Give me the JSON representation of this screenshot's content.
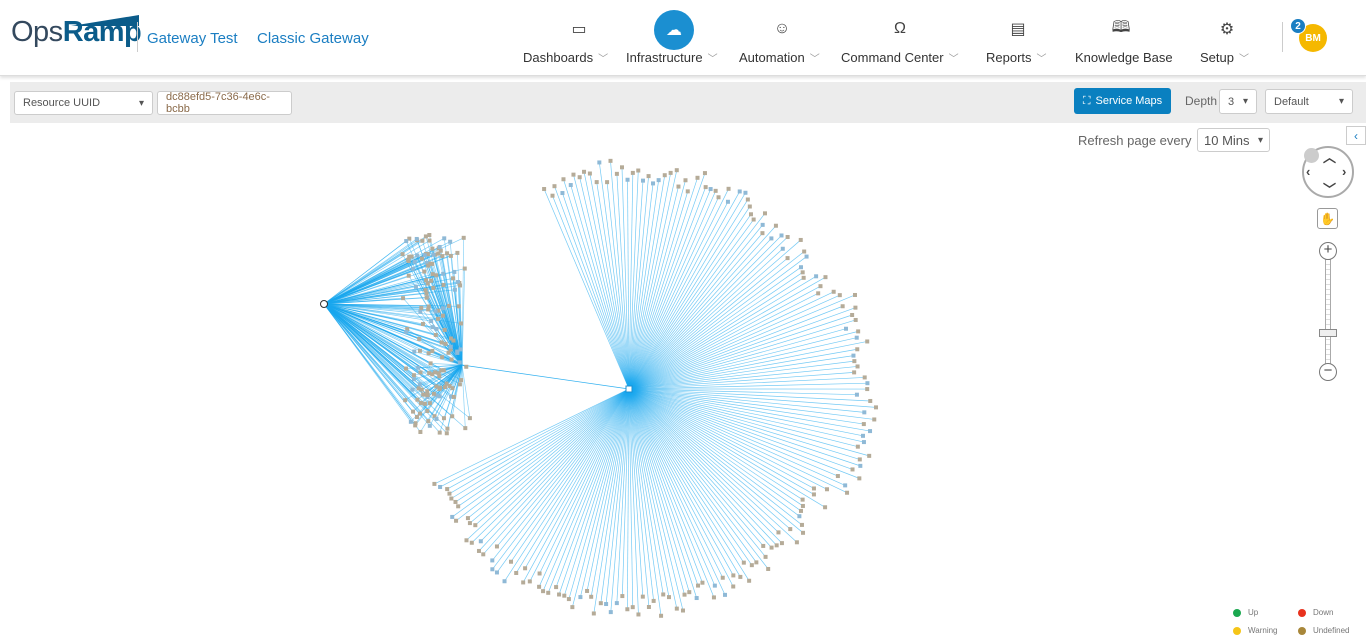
{
  "header": {
    "logo": "OpsRamp",
    "links": [
      "Gateway Test",
      "Classic Gateway"
    ],
    "nav": [
      {
        "label": "Dashboards",
        "icon": "dashboard-icon",
        "dropdown": true
      },
      {
        "label": "Infrastructure",
        "icon": "cloud-network-icon",
        "dropdown": true,
        "active": true
      },
      {
        "label": "Automation",
        "icon": "robot-icon",
        "dropdown": true
      },
      {
        "label": "Command Center",
        "icon": "headset-icon",
        "dropdown": true
      },
      {
        "label": "Reports",
        "icon": "report-chart-icon",
        "dropdown": true
      },
      {
        "label": "Knowledge Base",
        "icon": "book-icon",
        "dropdown": false
      },
      {
        "label": "Setup",
        "icon": "user-gear-icon",
        "dropdown": true
      }
    ],
    "notifications": "2",
    "avatar": "BM"
  },
  "toolbar": {
    "search_by": "Resource UUID",
    "search_value": "dc88efd5-7c36-4e6c-bcbb",
    "service_maps": "Service Maps",
    "depth_label": "Depth",
    "depth": "3",
    "view": "Default"
  },
  "refresh": {
    "label": "Refresh page every",
    "value": "10 Mins"
  },
  "legend": [
    {
      "label": "Up",
      "color": "#1aa84f"
    },
    {
      "label": "Down",
      "color": "#e8321e"
    },
    {
      "label": "Warning",
      "color": "#f5c518"
    },
    {
      "label": "Undefined",
      "color": "#a8873a"
    }
  ],
  "colors": {
    "accent": "#0a80c0",
    "edge": "#19a7ee",
    "node_a": "#b5ab98",
    "node_b": "#8fb9d6"
  }
}
